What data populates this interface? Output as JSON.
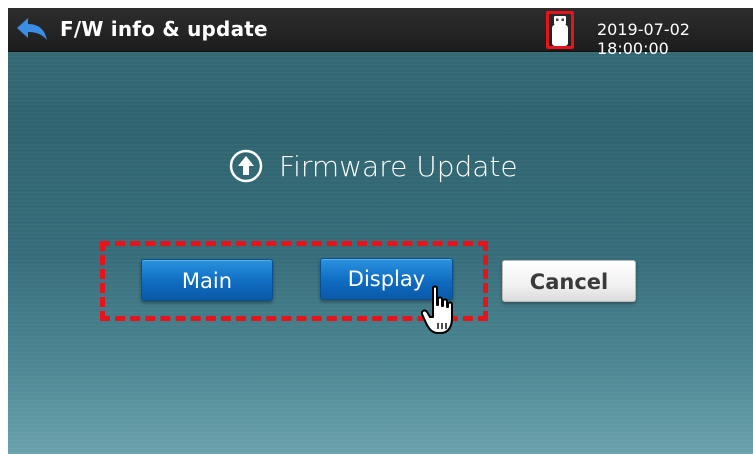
{
  "header": {
    "title": "F/W info & update",
    "datetime": "2019-07-02 18:00:00",
    "back_icon": "back-arrow-icon",
    "usb_icon": "usb-drive-icon"
  },
  "main": {
    "heading": "Firmware Update",
    "heading_icon": "upload-circle-icon",
    "buttons": {
      "main_label": "Main",
      "display_label": "Display",
      "cancel_label": "Cancel"
    },
    "cursor_icon": "hand-pointer-icon"
  },
  "colors": {
    "highlight": "#e8121b",
    "accent_blue": "#1877cc",
    "back_arrow": "#3a8ee6"
  }
}
